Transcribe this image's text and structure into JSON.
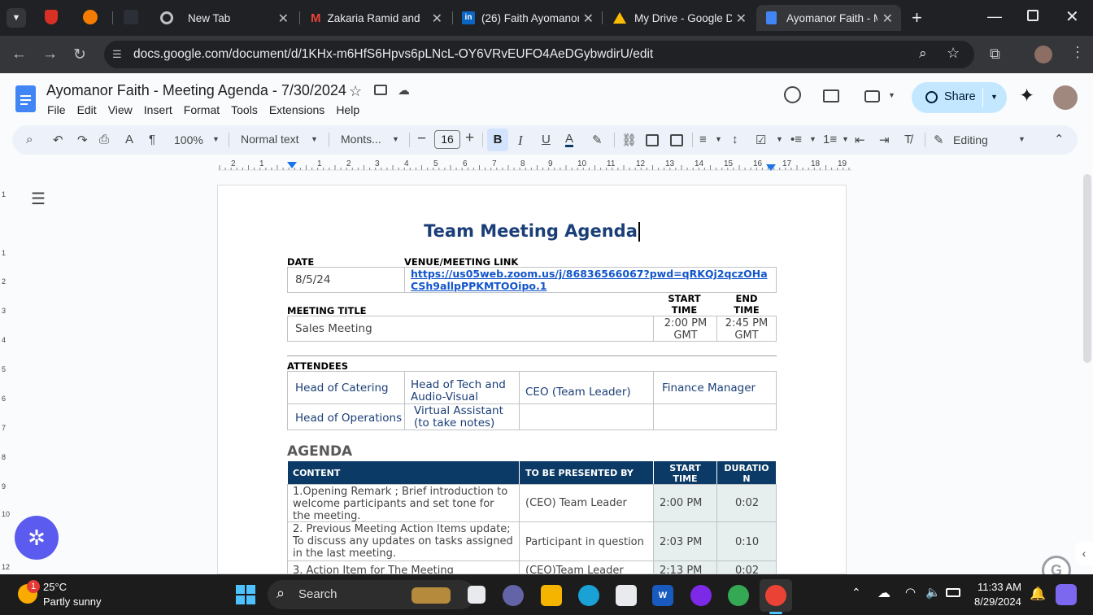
{
  "browser": {
    "tabs": [
      {
        "title": "New Tab"
      },
      {
        "title": "Zakaria Ramid and"
      },
      {
        "title": "(26) Faith Ayomanor"
      },
      {
        "title": "My Drive - Google D"
      },
      {
        "title": "Ayomanor Faith - M"
      }
    ],
    "url": "docs.google.com/document/d/1KHx-m6HfS6Hpvs6pLNcL-OY6VRvEUFO4AeDGybwdirU/edit"
  },
  "docs": {
    "title": "Ayomanor Faith - Meeting Agenda - 7/30/2024",
    "menus": [
      "File",
      "Edit",
      "View",
      "Insert",
      "Format",
      "Tools",
      "Extensions",
      "Help"
    ],
    "share_label": "Share",
    "toolbar": {
      "zoom": "100%",
      "style": "Normal text",
      "font": "Monts...",
      "font_size": "16",
      "mode": "Editing"
    },
    "ruler_numbers": [
      "2",
      "1",
      "1",
      "2",
      "3",
      "4",
      "5",
      "6",
      "7",
      "8",
      "9",
      "10",
      "11",
      "12",
      "13",
      "14",
      "15",
      "16",
      "17",
      "18",
      "19"
    ],
    "vruler_numbers": [
      "1",
      "1",
      "2",
      "3",
      "4",
      "5",
      "6",
      "7",
      "8",
      "9",
      "10",
      "12"
    ]
  },
  "document": {
    "heading": "Team Meeting Agenda",
    "date_label": "DATE",
    "date_value": "8/5/24",
    "venue_label": "VENUE/MEETING LINK",
    "venue_link": "https://us05web.zoom.us/j/86836566067?pwd=qRKQj2qczOHaCSh9allpPPKMTOOipo.1",
    "start_time_label": "START TIME",
    "end_time_label": "END TIME",
    "meeting_title_label": "MEETING TITLE",
    "meeting_title_value": "Sales Meeting",
    "start_time_value": "2:00 PM GMT",
    "end_time_value": "2:45 PM GMT",
    "attendees_label": "ATTENDEES",
    "attendees": [
      [
        "Head of Catering",
        "Head of Tech and Audio-Visual",
        "CEO (Team Leader)",
        "Finance Manager"
      ],
      [
        "Head of Operations",
        "Virtual Assistant (to take notes)",
        "",
        ""
      ]
    ],
    "agenda_heading": "AGENDA",
    "agenda_columns": [
      "CONTENT",
      "TO BE PRESENTED BY",
      "START TIME",
      "DURATIO N"
    ],
    "agenda_rows": [
      {
        "content": "1.Opening Remark ; Brief introduction to welcome participants and set tone for the meeting.",
        "presenter": "(CEO) Team Leader",
        "start": "2:00 PM",
        "duration": "0:02"
      },
      {
        "content": "2. Previous Meeting Action Items update; To discuss any updates on tasks assigned in the last meeting.",
        "presenter": "Participant in question",
        "start": "2:03 PM",
        "duration": "0:10"
      },
      {
        "content": "3. Action Item for The Meeting",
        "presenter": "(CEO)Team Leader",
        "start": "2:13 PM",
        "duration": "0:02"
      }
    ]
  },
  "taskbar": {
    "weather_temp": "25°C",
    "weather_desc": "Partly sunny",
    "search_label": "Search",
    "time": "11:33 AM",
    "date": "8/29/2024",
    "notification_count": "1"
  },
  "colors": {
    "accent": "#0b3a66",
    "heading_blue": "#1a3e77",
    "share_bg": "#c2e7ff"
  }
}
